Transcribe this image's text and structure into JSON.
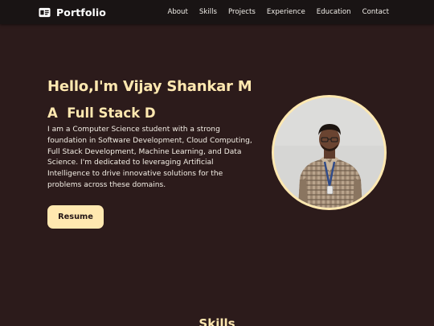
{
  "navbar": {
    "brand": {
      "icon": "id-card-icon",
      "label": "Portfolio"
    },
    "links": [
      {
        "label": "About"
      },
      {
        "label": "Skills"
      },
      {
        "label": "Projects"
      },
      {
        "label": "Experience"
      },
      {
        "label": "Education"
      },
      {
        "label": "Contact"
      }
    ]
  },
  "hero": {
    "title": "Hello,I'm Vijay Shankar M",
    "subtitle": "A  Full Stack D",
    "description": "I am a Computer Science student with a strong foundation in Software Development, Cloud Computing, Full Stack Development, Machine Learning, and Data Science. I'm dedicated to leveraging Artificial Intelligence to drive innovative solutions for the problems across these domains.",
    "resume_label": "Resume"
  },
  "skills": {
    "title": "Skills"
  },
  "colors": {
    "background": "#2c1b1b",
    "navbar": "#191414",
    "accent": "#ffe8b0",
    "text": "#f4efe6"
  }
}
